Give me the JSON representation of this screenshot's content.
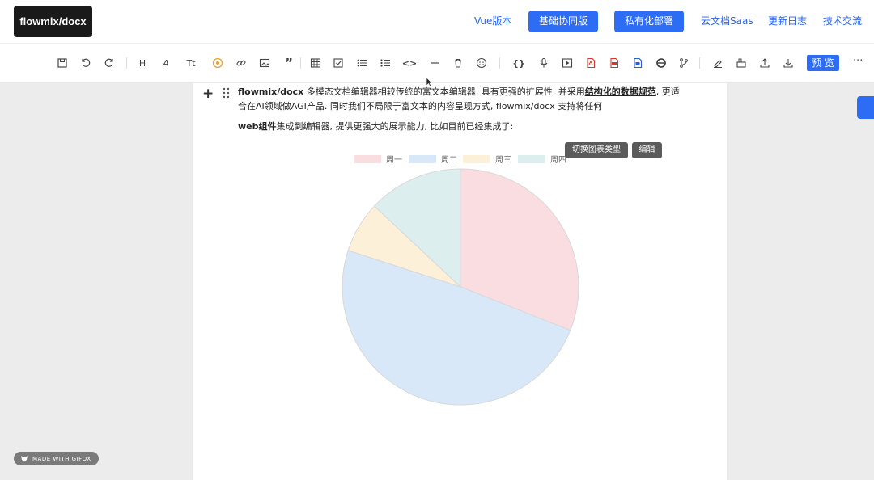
{
  "header": {
    "logo": "flowmix/docx",
    "nav": [
      {
        "label": "Vue版本",
        "style": "link"
      },
      {
        "label": "基础协同版",
        "style": "button"
      },
      {
        "label": "私有化部署",
        "style": "button"
      },
      {
        "label": "云文档Saas",
        "style": "link"
      },
      {
        "label": "更新日志",
        "style": "link"
      },
      {
        "label": "技术交流",
        "style": "link"
      }
    ]
  },
  "toolbar": {
    "icons": [
      "save-icon",
      "undo-icon",
      "redo-icon",
      "heading-icon",
      "font-style-icon",
      "font-size-icon",
      "ai-icon",
      "link-icon",
      "image-icon",
      "quote-icon",
      "table-icon",
      "checkbox-list-icon",
      "ordered-list-icon",
      "bullet-list-icon",
      "code-icon",
      "divider-icon",
      "delete-icon",
      "emoji-icon",
      "code-block-icon",
      "audio-icon",
      "video-icon",
      "pdf-icon",
      "pdf-export-icon",
      "word-icon",
      "ie-icon",
      "branch-icon",
      "sign-icon",
      "template-icon",
      "upload-icon",
      "download-icon"
    ],
    "glyphs": {
      "heading": "H",
      "font_style": "A",
      "font_size": "Tt",
      "quote": "”",
      "code": "<>",
      "code_block": "{}"
    },
    "preview_label": "预 览",
    "more_label": "···"
  },
  "document": {
    "para1": {
      "brand": "flowmix/docx",
      "text1": " 多模态文档编辑器相较传统的富文本编辑器, 具有更强的扩展性, 并采用",
      "underlined": "结构化的数据规范",
      "text2": ", 更适合在AI领域做AGI产品. 同时我们不局限于富文本的内容呈现方式, flowmix/docx 支持将任何"
    },
    "para2": {
      "brand": "web组件",
      "text": "集成到编辑器, 提供更强大的展示能力, 比如目前已经集成了:"
    },
    "chart_buttons": {
      "switch_type": "切换图表类型",
      "edit": "编辑"
    }
  },
  "chart_data": {
    "type": "pie",
    "categories": [
      "周一",
      "周二",
      "周三",
      "周四"
    ],
    "values": [
      31,
      49,
      7,
      13
    ],
    "colors": [
      "#fadde1",
      "#d9e8f8",
      "#fdf0d9",
      "#dceeee"
    ],
    "stroke": "#d8d8d8",
    "legend_position": "top"
  },
  "footer": {
    "badge": "MADE WITH GIFOX"
  },
  "colors": {
    "accent": "#2d6df6",
    "logo_bg": "#1a1a1a"
  }
}
